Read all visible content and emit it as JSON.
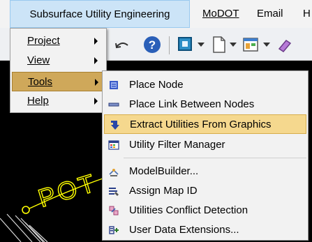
{
  "menubar": {
    "items": [
      {
        "label": "Subsurface Utility Engineering"
      },
      {
        "label": "MoDOT"
      },
      {
        "label": "Email"
      },
      {
        "label": "H"
      }
    ]
  },
  "main_menu": {
    "items": [
      {
        "label": "Project"
      },
      {
        "label": "View"
      },
      {
        "label": "Tools"
      },
      {
        "label": "Help"
      }
    ]
  },
  "tools_submenu": {
    "items": [
      {
        "label": "Place Node",
        "icon": "place-node-icon"
      },
      {
        "label": "Place Link Between Nodes",
        "icon": "place-link-icon"
      },
      {
        "label": "Extract Utilities From Graphics",
        "icon": "extract-icon"
      },
      {
        "label": "Utility Filter Manager",
        "icon": "filter-manager-icon"
      },
      {
        "label": "ModelBuilder...",
        "icon": "model-builder-icon"
      },
      {
        "label": "Assign Map ID",
        "icon": "assign-map-id-icon"
      },
      {
        "label": "Utilities Conflict Detection",
        "icon": "conflict-detection-icon"
      },
      {
        "label": "User Data Extensions...",
        "icon": "user-data-extensions-icon"
      }
    ]
  },
  "canvas": {
    "text": "POT S"
  },
  "colors": {
    "highlight_selected": "#f5d88e",
    "tools_selected": "#cfa85a",
    "menubar_active": "#cce4f7"
  }
}
